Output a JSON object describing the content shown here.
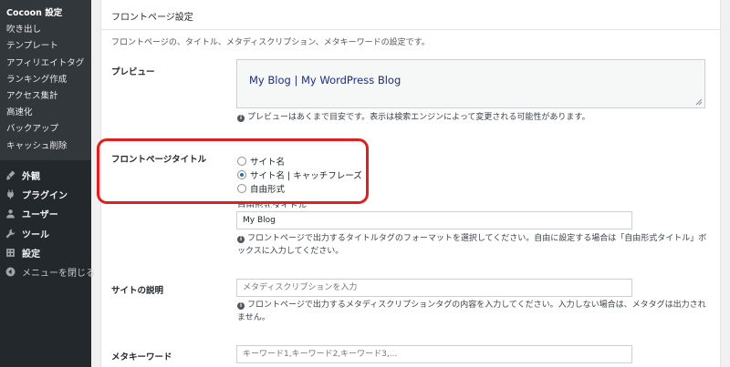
{
  "sidebar": {
    "subitems": [
      {
        "label": "Cocoon 設定",
        "current": true
      },
      {
        "label": "吹き出し"
      },
      {
        "label": "テンプレート"
      },
      {
        "label": "アフィリエイトタグ"
      },
      {
        "label": "ランキング作成"
      },
      {
        "label": "アクセス集計"
      },
      {
        "label": "高速化"
      },
      {
        "label": "バックアップ"
      },
      {
        "label": "キャッシュ削除"
      }
    ],
    "menu": [
      {
        "label": "外観",
        "icon": "paintbrush-icon"
      },
      {
        "label": "プラグイン",
        "icon": "plugin-icon"
      },
      {
        "label": "ユーザー",
        "icon": "user-icon"
      },
      {
        "label": "ツール",
        "icon": "wrench-icon"
      },
      {
        "label": "設定",
        "icon": "settings-icon"
      },
      {
        "label": "メニューを閉じる",
        "icon": "collapse-icon"
      }
    ]
  },
  "panel": {
    "title": "フロントページ設定",
    "description": "フロントページの、タイトル、メタディスクリプション、メタキーワードの設定です。"
  },
  "preview": {
    "label": "プレビュー",
    "text": "My Blog | My WordPress Blog",
    "note": "プレビューはあくまで目安です。表示は検索エンジンによって変更される可能性があります。"
  },
  "front_title": {
    "label": "フロントページタイトル",
    "options": [
      "サイト名",
      "サイト名 | キャッチフレーズ",
      "自由形式"
    ],
    "selected_index": 1,
    "custom_label": "自由形式タイトル",
    "custom_value": "My Blog",
    "note": "フロントページで出力するタイトルタグのフォーマットを選択してください。自由に設定する場合は「自由形式タイトル」ボックスに入力してください。"
  },
  "site_desc": {
    "label": "サイトの説明",
    "placeholder": "メタディスクリプションを入力",
    "note": "フロントページで出力するメタディスクリプションタグの内容を入力してください。入力しない場合は、メタタグは出力されません。"
  },
  "meta_keywords": {
    "label": "メタキーワード",
    "placeholder": "キーワード1,キーワード2,キーワード3,..."
  },
  "colors": {
    "sidebar_bg": "#23282d",
    "submenu_bg": "#32373c",
    "highlight": "#e02020",
    "preview_text": "#1d2c8a",
    "radio_checked": "#2271b1"
  }
}
